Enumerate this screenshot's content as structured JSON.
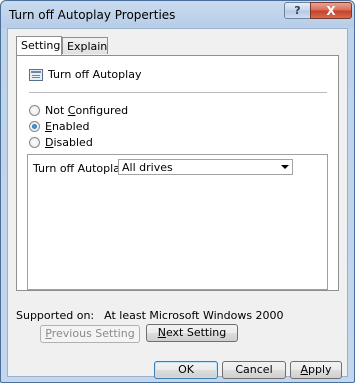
{
  "window": {
    "title": "Turn off Autoplay Properties",
    "help_glyph": "?",
    "close_glyph": "X"
  },
  "tabs": [
    {
      "label": "Setting",
      "selected": true
    },
    {
      "label": "Explain",
      "selected": false
    }
  ],
  "policy": {
    "name": "Turn off Autoplay",
    "icon": "policy-icon"
  },
  "radios": [
    {
      "label": "Not Configured",
      "underline": "C",
      "checked": false
    },
    {
      "label": "Enabled",
      "underline": "E",
      "checked": true
    },
    {
      "label": "Disabled",
      "underline": "D",
      "checked": false
    }
  ],
  "options": {
    "label": "Turn off Autoplay on:",
    "combo_value": "All drives"
  },
  "supported": {
    "label": "Supported on:",
    "value": "At least Microsoft Windows 2000"
  },
  "nav_buttons": {
    "previous": "Previous Setting",
    "next": "Next Setting"
  },
  "footer_buttons": {
    "ok": "OK",
    "cancel": "Cancel",
    "apply": "Apply"
  }
}
